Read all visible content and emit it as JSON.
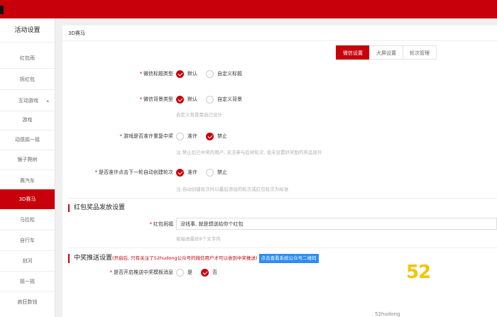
{
  "sidebar": {
    "title": "活动设置",
    "items": [
      {
        "label": "红包雨"
      },
      {
        "label": "拆红包"
      },
      {
        "label": "互动游戏"
      },
      {
        "label": "游戏"
      },
      {
        "label": "动感摇一摇"
      },
      {
        "label": "猴子爬树"
      },
      {
        "label": "赛汽车"
      },
      {
        "label": "3D赛马"
      },
      {
        "label": "马拉松"
      },
      {
        "label": "自行车"
      },
      {
        "label": "划河"
      },
      {
        "label": "摇一摇"
      },
      {
        "label": "疯狂数钱"
      }
    ]
  },
  "breadcrumb": "3D赛马",
  "tabs": [
    {
      "label": "微信设置"
    },
    {
      "label": "大屏设置"
    },
    {
      "label": "轮次管理"
    }
  ],
  "form": {
    "title_type": {
      "label": "微信标题类型",
      "options": [
        "默认",
        "自定义标题"
      ]
    },
    "bg_type": {
      "label": "微信背景类型",
      "options": [
        "默认",
        "自定义背景"
      ],
      "hint": "自定义背景需自己设计"
    },
    "repeat_win": {
      "label": "游戏是否准许重复中奖",
      "options": [
        "准许",
        "禁止"
      ],
      "hint": "注:禁止后已中奖的用户, 无法参与后续轮次, 但未设置好奖励的奖品除外"
    },
    "auto_round": {
      "label": "是否准许点击下一轮自动创建轮次",
      "options": [
        "准许",
        "禁止"
      ],
      "hint": "注:自动创建轮次时以最后添加的轮次或红包轮次为标准"
    }
  },
  "redpack_section": {
    "title": "红包奖品发放设置",
    "blessing_label": "红包祝福",
    "blessing_value": "没钱事, 就是想送给你个红包",
    "blessing_hint": "祝福语最好8个文字内"
  },
  "push_section": {
    "title": "中奖推送设置",
    "note": "(开启后, 只有关注了52hudong公众号的微信用户才可以收到中奖推送)",
    "badge": "点击查看系统公众号二维码",
    "push_label": "是否开启推送中奖模板消息",
    "options": [
      "是",
      "否"
    ]
  },
  "watermark": "52",
  "bottom_text": "52hudong",
  "colors": {
    "brand_red": "#c7000b",
    "badge_blue": "#2d8cf0",
    "watermark_yellow": "#f5c400"
  }
}
